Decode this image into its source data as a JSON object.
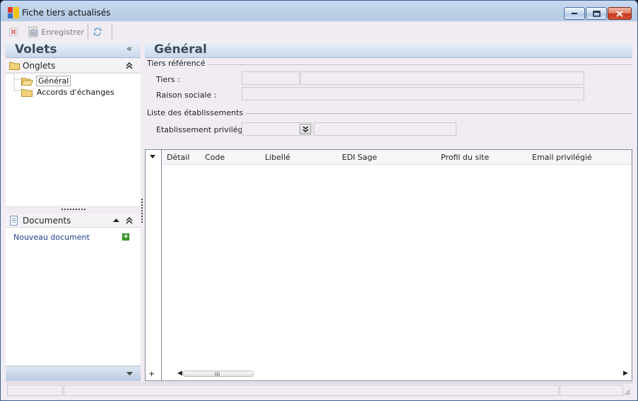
{
  "window": {
    "title": "Fiche tiers actualisés"
  },
  "toolbar": {
    "save_label": "Enregistrer"
  },
  "left_panel": {
    "title": "Volets",
    "collapse_glyph": "«",
    "onglets": {
      "label": "Onglets",
      "items": [
        {
          "label": "Général",
          "selected": true
        },
        {
          "label": "Accords d'échanges",
          "selected": false
        }
      ]
    },
    "documents": {
      "label": "Documents",
      "new_document": "Nouveau document"
    }
  },
  "main": {
    "title": "Général",
    "tiers_group": {
      "title": "Tiers référencé",
      "tiers_label": "Tiers :",
      "tiers_code": "",
      "tiers_name": "",
      "raison_label": "Raison sociale :",
      "raison_value": ""
    },
    "etab_group": {
      "title": "Liste des établissements",
      "etab_label": "Etablissement privilégié :",
      "etab_value": "",
      "etab_name": ""
    },
    "grid": {
      "columns": [
        "Détail",
        "Code",
        "Libellé",
        "EDI Sage",
        "Profil du site",
        "Email privilégié"
      ],
      "rows": [],
      "add_glyph": "+"
    }
  },
  "colors": {
    "accent": "#3c4a5a",
    "link": "#1f3e8c",
    "add_green": "#3f9b2f"
  }
}
